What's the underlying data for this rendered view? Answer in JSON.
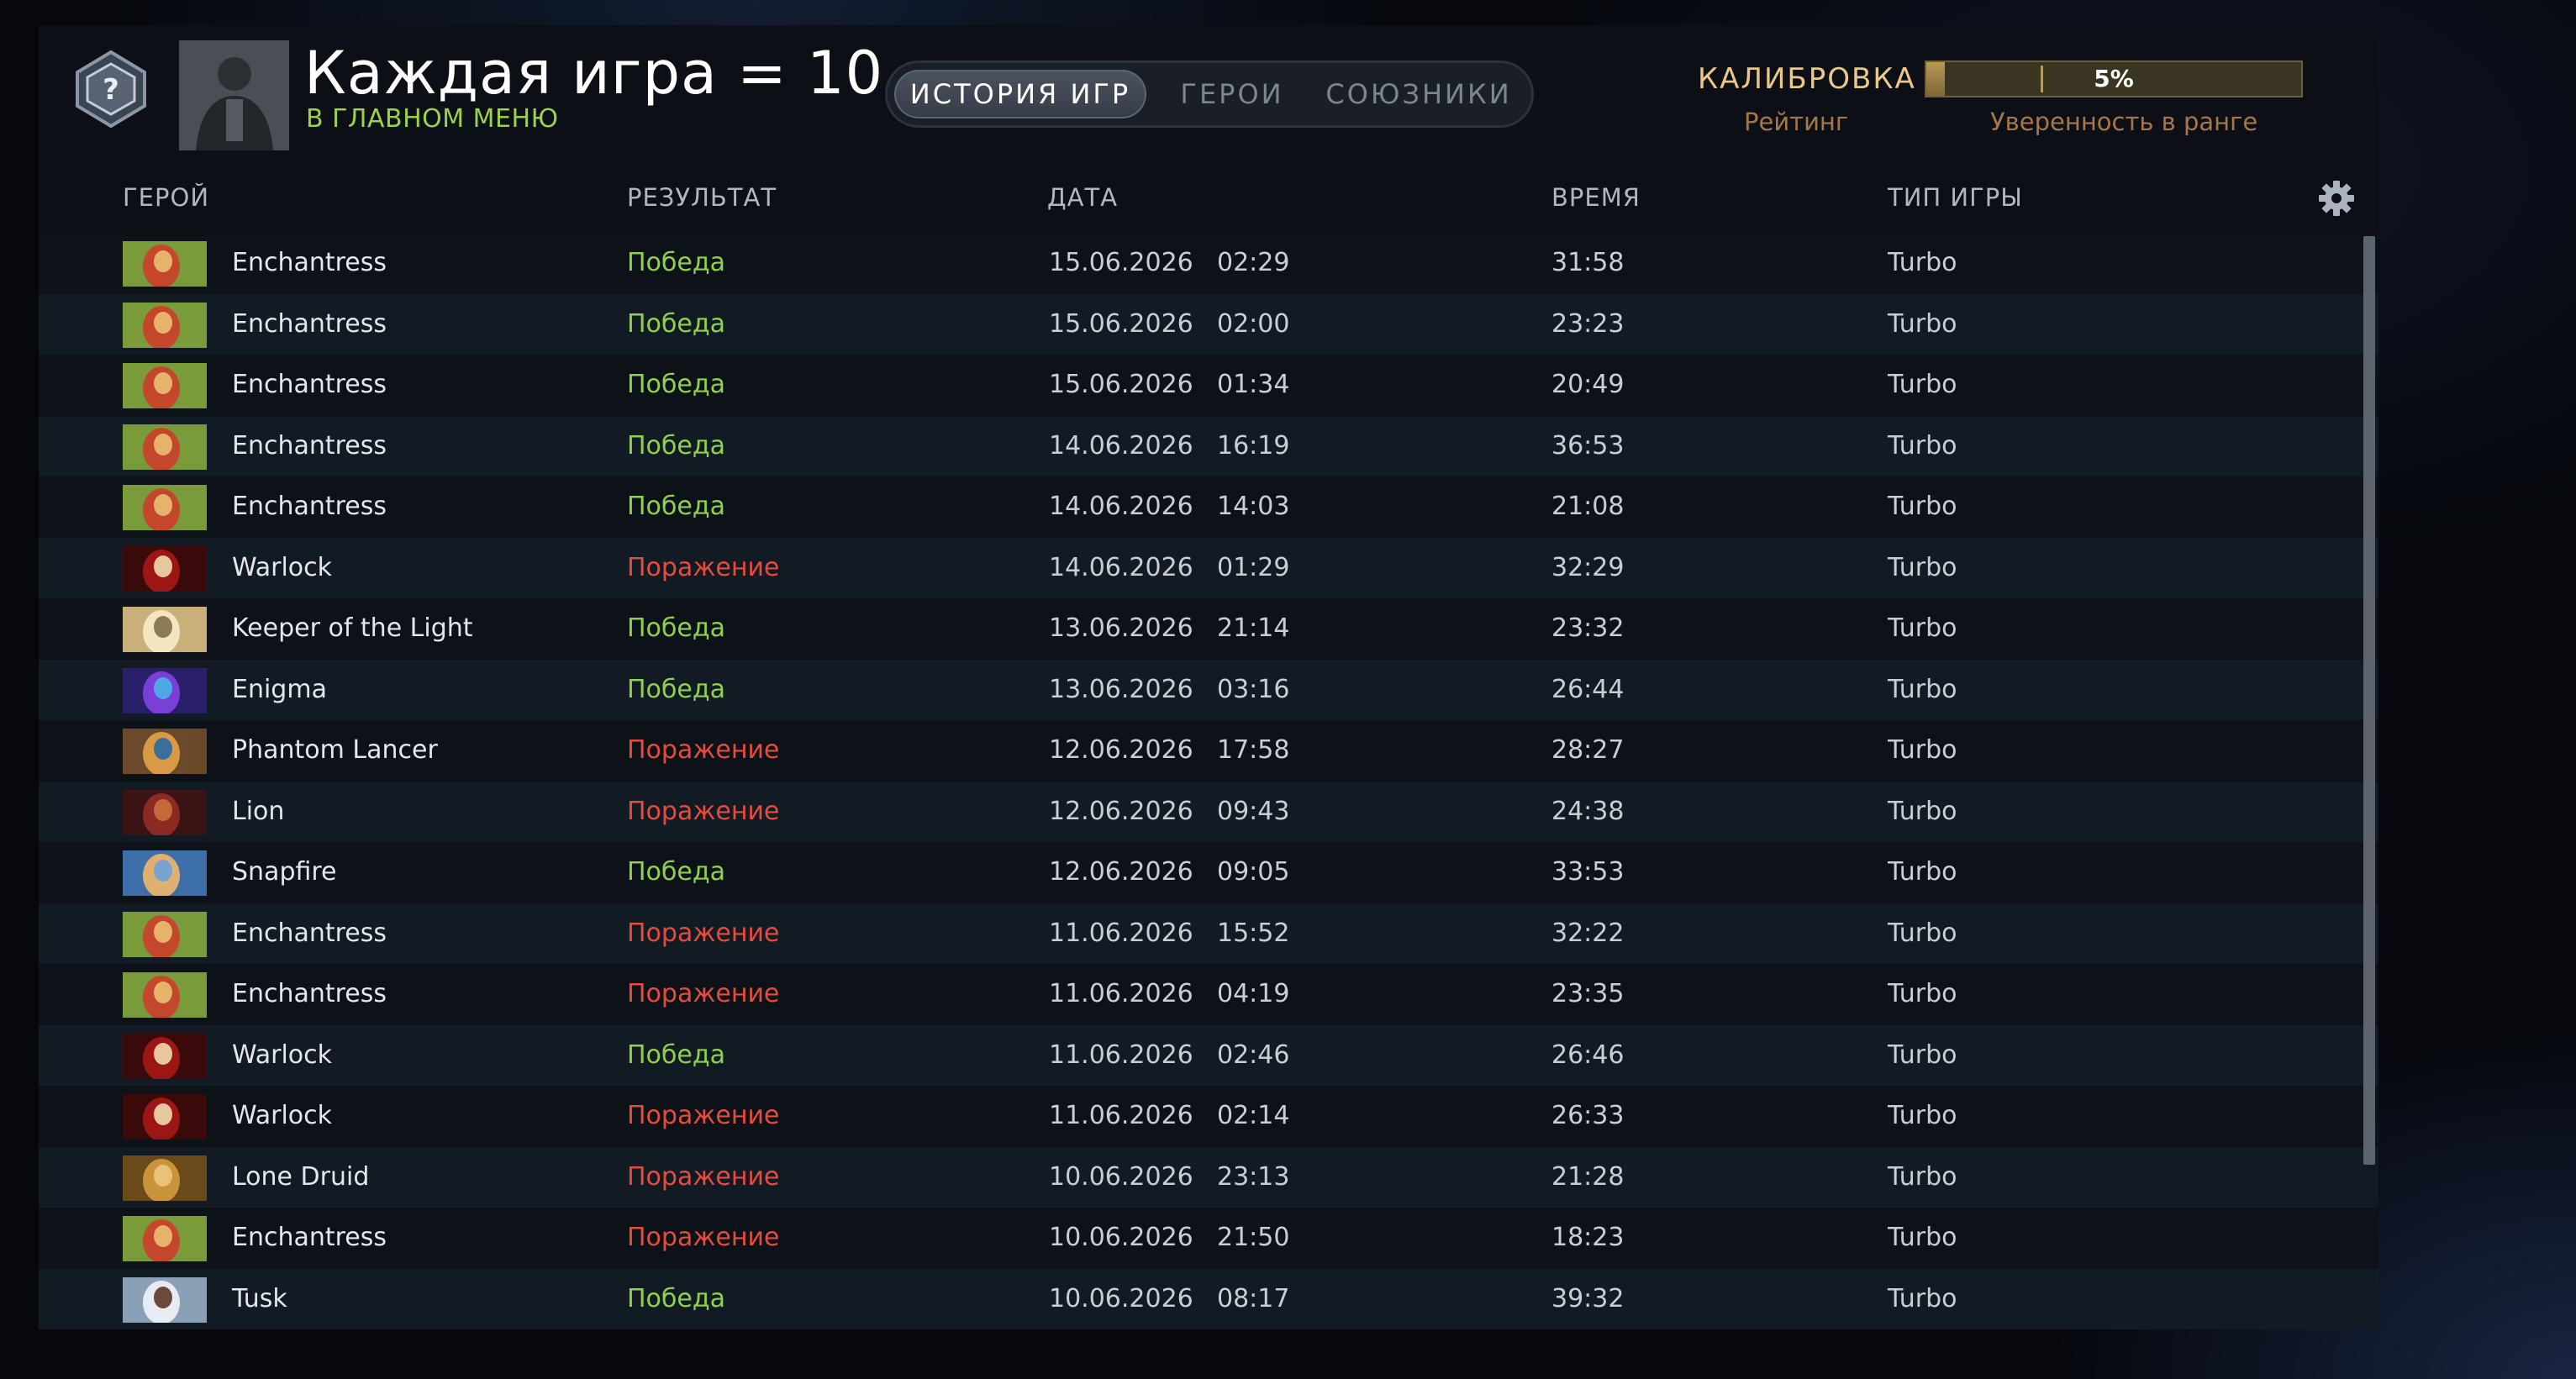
{
  "colors": {
    "win": "#8fd14a",
    "loss": "#e64b3c",
    "accent_gold": "#e9c98a",
    "subtitle_green": "#9bd24a"
  },
  "header": {
    "title": "Каждая игра = 10 ...",
    "subtitle": "В ГЛАВНОМ МЕНЮ",
    "rank_icon": "uncalibrated-rank-icon",
    "portrait_icon": "player-avatar"
  },
  "tabs": [
    {
      "label": "ИСТОРИЯ ИГР",
      "active": true
    },
    {
      "label": "ГЕРОИ",
      "active": false
    },
    {
      "label": "СОЮЗНИКИ",
      "active": false
    }
  ],
  "calibration": {
    "label": "КАЛИБРОВКА",
    "rating_label": "Рейтинг",
    "confidence_label": "Уверенность в ранге",
    "progress_text": "5%",
    "progress_value": 0.05
  },
  "table": {
    "columns": [
      "ГЕРОЙ",
      "РЕЗУЛЬТАТ",
      "ДАТА",
      "ВРЕМЯ",
      "ТИП ИГРЫ"
    ],
    "settings_icon": "gear-icon",
    "rows": [
      {
        "hero": "Enchantress",
        "result": "Победа",
        "win": true,
        "date": "15.06.2026",
        "time": "02:29",
        "duration": "31:58",
        "type": "Turbo"
      },
      {
        "hero": "Enchantress",
        "result": "Победа",
        "win": true,
        "date": "15.06.2026",
        "time": "02:00",
        "duration": "23:23",
        "type": "Turbo"
      },
      {
        "hero": "Enchantress",
        "result": "Победа",
        "win": true,
        "date": "15.06.2026",
        "time": "01:34",
        "duration": "20:49",
        "type": "Turbo"
      },
      {
        "hero": "Enchantress",
        "result": "Победа",
        "win": true,
        "date": "14.06.2026",
        "time": "16:19",
        "duration": "36:53",
        "type": "Turbo"
      },
      {
        "hero": "Enchantress",
        "result": "Победа",
        "win": true,
        "date": "14.06.2026",
        "time": "14:03",
        "duration": "21:08",
        "type": "Turbo"
      },
      {
        "hero": "Warlock",
        "result": "Поражение",
        "win": false,
        "date": "14.06.2026",
        "time": "01:29",
        "duration": "32:29",
        "type": "Turbo"
      },
      {
        "hero": "Keeper of the Light",
        "result": "Победа",
        "win": true,
        "date": "13.06.2026",
        "time": "21:14",
        "duration": "23:32",
        "type": "Turbo"
      },
      {
        "hero": "Enigma",
        "result": "Победа",
        "win": true,
        "date": "13.06.2026",
        "time": "03:16",
        "duration": "26:44",
        "type": "Turbo"
      },
      {
        "hero": "Phantom Lancer",
        "result": "Поражение",
        "win": false,
        "date": "12.06.2026",
        "time": "17:58",
        "duration": "28:27",
        "type": "Turbo"
      },
      {
        "hero": "Lion",
        "result": "Поражение",
        "win": false,
        "date": "12.06.2026",
        "time": "09:43",
        "duration": "24:38",
        "type": "Turbo"
      },
      {
        "hero": "Snapfire",
        "result": "Победа",
        "win": true,
        "date": "12.06.2026",
        "time": "09:05",
        "duration": "33:53",
        "type": "Turbo"
      },
      {
        "hero": "Enchantress",
        "result": "Поражение",
        "win": false,
        "date": "11.06.2026",
        "time": "15:52",
        "duration": "32:22",
        "type": "Turbo"
      },
      {
        "hero": "Enchantress",
        "result": "Поражение",
        "win": false,
        "date": "11.06.2026",
        "time": "04:19",
        "duration": "23:35",
        "type": "Turbo"
      },
      {
        "hero": "Warlock",
        "result": "Победа",
        "win": true,
        "date": "11.06.2026",
        "time": "02:46",
        "duration": "26:46",
        "type": "Turbo"
      },
      {
        "hero": "Warlock",
        "result": "Поражение",
        "win": false,
        "date": "11.06.2026",
        "time": "02:14",
        "duration": "26:33",
        "type": "Turbo"
      },
      {
        "hero": "Lone Druid",
        "result": "Поражение",
        "win": false,
        "date": "10.06.2026",
        "time": "23:13",
        "duration": "21:28",
        "type": "Turbo"
      },
      {
        "hero": "Enchantress",
        "result": "Поражение",
        "win": false,
        "date": "10.06.2026",
        "time": "21:50",
        "duration": "18:23",
        "type": "Turbo"
      },
      {
        "hero": "Tusk",
        "result": "Победа",
        "win": true,
        "date": "10.06.2026",
        "time": "08:17",
        "duration": "39:32",
        "type": "Turbo"
      }
    ]
  }
}
